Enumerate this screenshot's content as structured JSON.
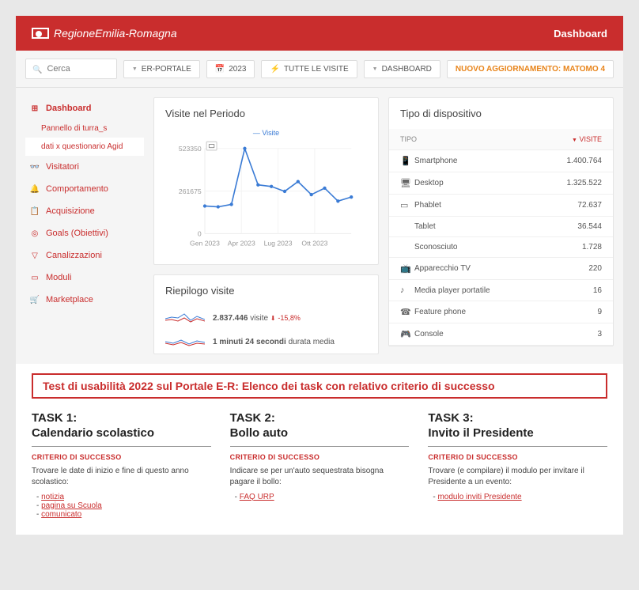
{
  "header": {
    "brand": "RegioneEmilia-Romagna",
    "nav": "Dashboard"
  },
  "toolbar": {
    "search_placeholder": "Cerca",
    "crumb_portal": "ER-PORTALE",
    "crumb_year": "2023",
    "crumb_visits": "TUTTE LE VISITE",
    "crumb_dash": "DASHBOARD",
    "update_notice": "NUOVO AGGIORNAMENTO: MATOMO 4"
  },
  "sidebar": {
    "items": [
      {
        "label": "Dashboard",
        "icon": "⊞"
      },
      {
        "label": "Visitatori",
        "icon": "👓"
      },
      {
        "label": "Comportamento",
        "icon": "🔔"
      },
      {
        "label": "Acquisizione",
        "icon": "📋"
      },
      {
        "label": "Goals (Obiettivi)",
        "icon": "◎"
      },
      {
        "label": "Canalizzazioni",
        "icon": "▽"
      },
      {
        "label": "Moduli",
        "icon": "▭"
      },
      {
        "label": "Marketplace",
        "icon": "🛒"
      }
    ],
    "sub1": "Pannello di turra_s",
    "sub2": "dati x questionario Agid"
  },
  "chart": {
    "title": "Visite nel Periodo",
    "legend": "Visite"
  },
  "chart_data": {
    "type": "line",
    "title": "Visite nel Periodo",
    "series_name": "Visite",
    "x": [
      "Gen 2023",
      "Feb 2023",
      "Mar 2023",
      "Apr 2023",
      "Mag 2023",
      "Giu 2023",
      "Lug 2023",
      "Ago 2023",
      "Set 2023",
      "Ott 2023",
      "Nov 2023",
      "Dic 2023"
    ],
    "y": [
      170000,
      165000,
      180000,
      523350,
      300000,
      290000,
      260000,
      320000,
      240000,
      280000,
      200000,
      225000
    ],
    "ylim": [
      0,
      523350
    ],
    "y_ticks": [
      0,
      261675,
      523350
    ],
    "x_ticks": [
      "Gen 2023",
      "Apr 2023",
      "Lug 2023",
      "Ott 2023"
    ]
  },
  "summary": {
    "title": "Riepilogo visite",
    "rows": [
      {
        "value": "2.837.446",
        "label": "visite",
        "change": "-15,8%"
      },
      {
        "value": "1 minuti 24 secondi",
        "label": "durata media"
      }
    ]
  },
  "devices": {
    "title": "Tipo di dispositivo",
    "col_type": "TIPO",
    "col_visits": "VISITE",
    "rows": [
      {
        "icon": "📱",
        "name": "Smartphone",
        "value": "1.400.764"
      },
      {
        "icon": "🖥",
        "name": "Desktop",
        "value": "1.325.522"
      },
      {
        "icon": "▭",
        "name": "Phablet",
        "value": "72.637"
      },
      {
        "icon": "",
        "name": "Tablet",
        "value": "36.544"
      },
      {
        "icon": "",
        "name": "Sconosciuto",
        "value": "1.728"
      },
      {
        "icon": "📺",
        "name": "Apparecchio TV",
        "value": "220"
      },
      {
        "icon": "♪",
        "name": "Media player portatile",
        "value": "16"
      },
      {
        "icon": "☎",
        "name": "Feature phone",
        "value": "9"
      },
      {
        "icon": "🎮",
        "name": "Console",
        "value": "3"
      }
    ]
  },
  "tasks": {
    "banner": "Test di usabilità 2022 sul Portale E-R: Elenco dei task con relativo criterio di successo",
    "criterio_label": "CRITERIO DI SUCCESSO",
    "cols": [
      {
        "title_line1": "TASK 1:",
        "title_line2": "Calendario scolastico",
        "desc": "Trovare le date di inizio e fine di questo anno scolastico:",
        "links": [
          "notizia",
          "pagina su Scuola",
          "comunicato"
        ]
      },
      {
        "title_line1": "TASK 2:",
        "title_line2": "Bollo auto",
        "desc": "Indicare se per un'auto sequestrata bisogna pagare il bollo:",
        "links": [
          "FAQ URP"
        ]
      },
      {
        "title_line1": "TASK 3:",
        "title_line2": "Invito il Presidente",
        "desc": "Trovare (e compilare) il modulo per invitare il Presidente a un evento:",
        "links": [
          "modulo inviti Presidente"
        ]
      }
    ]
  }
}
